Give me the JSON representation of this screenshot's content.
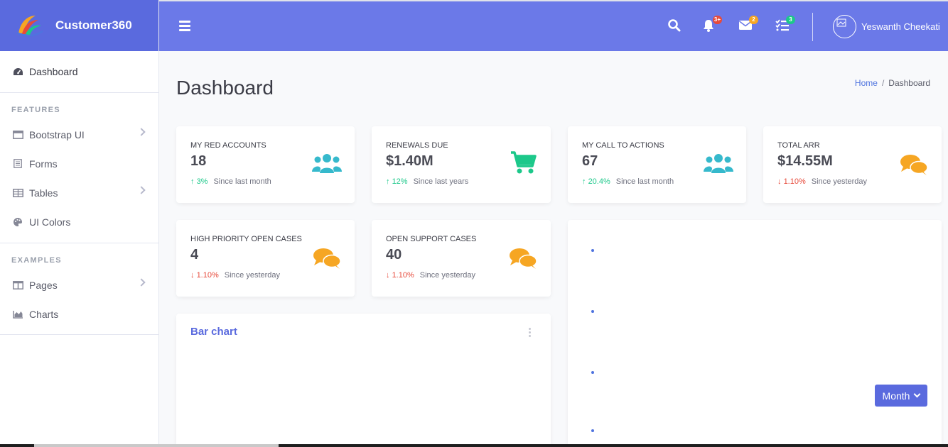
{
  "brand": {
    "title": "Customer360"
  },
  "sidebar": {
    "dashboard": "Dashboard",
    "features_heading": "FEATURES",
    "features": [
      {
        "label": "Bootstrap UI",
        "icon": "window-icon"
      },
      {
        "label": "Forms",
        "icon": "form-icon"
      },
      {
        "label": "Tables",
        "icon": "table-icon"
      },
      {
        "label": "UI Colors",
        "icon": "palette-icon"
      }
    ],
    "examples_heading": "EXAMPLES",
    "examples": [
      {
        "label": "Pages",
        "icon": "columns-icon"
      },
      {
        "label": "Charts",
        "icon": "area-chart-icon"
      }
    ]
  },
  "topbar": {
    "alerts_badge": "3+",
    "messages_badge": "2",
    "tasks_badge": "3",
    "user_name": "Yeswanth Cheekati"
  },
  "page": {
    "title": "Dashboard"
  },
  "breadcrumb": {
    "home": "Home",
    "current": "Dashboard"
  },
  "stats": [
    {
      "label": "MY RED ACCOUNTS",
      "value": "18",
      "trend": "3%",
      "direction": "up",
      "note": "Since last month",
      "icon": "users-icon",
      "color": "#36b9cc"
    },
    {
      "label": "RENEWALS DUE",
      "value": "$1.40M",
      "trend": "12%",
      "direction": "up",
      "note": "Since last years",
      "icon": "cart-icon",
      "color": "#1cc88a"
    },
    {
      "label": "MY CALL TO ACTIONS",
      "value": "67",
      "trend": "20.4%",
      "direction": "up",
      "note": "Since last month",
      "icon": "users-icon",
      "color": "#36b9cc"
    },
    {
      "label": "TOTAL ARR",
      "value": "$14.55M",
      "trend": "1.10%",
      "direction": "down",
      "note": "Since yesterday",
      "icon": "comments-icon",
      "color": "#f6a623"
    },
    {
      "label": "HIGH PRIORITY OPEN CASES",
      "value": "4",
      "trend": "1.10%",
      "direction": "down",
      "note": "Since yesterday",
      "icon": "comments-icon",
      "color": "#f6a623"
    },
    {
      "label": "OPEN SUPPORT CASES",
      "value": "40",
      "trend": "1.10%",
      "direction": "down",
      "note": "Since yesterday",
      "icon": "comments-icon",
      "color": "#f6a623"
    }
  ],
  "bar_chart": {
    "title": "Bar chart"
  },
  "month_button": "Month",
  "colors": {
    "brand": "#5a6ade",
    "topbar": "#6b79e8",
    "up": "#1cc88a",
    "down": "#e74a3b"
  }
}
